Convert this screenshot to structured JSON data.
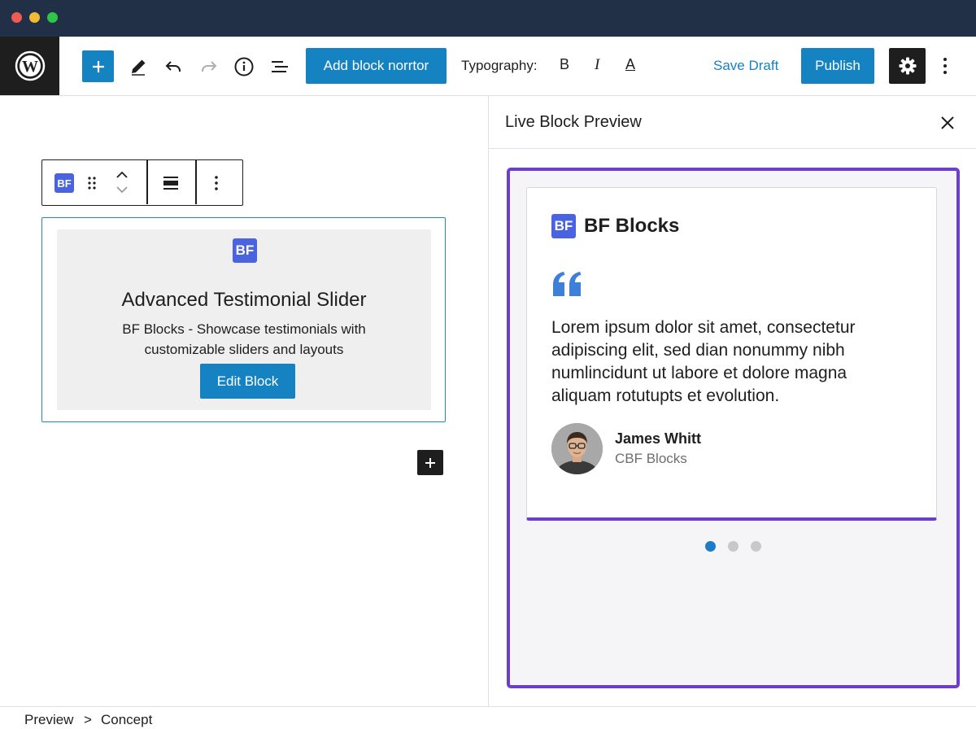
{
  "window": {
    "controls": [
      "close",
      "minimize",
      "zoom"
    ]
  },
  "toolbar": {
    "logo_icon": "wordpress-logo",
    "add_block_icon": "plus-icon",
    "tools": [
      "pencil-icon",
      "undo-icon",
      "redo-icon",
      "info-icon",
      "list-view-icon"
    ],
    "add_block_button": "Add block norrtor",
    "typography_label": "Typography:",
    "bold": "B",
    "italic": "I",
    "text_color": "A",
    "save_draft": "Save Draft",
    "publish": "Publish",
    "settings_icon": "gear-icon",
    "more_icon": "more-vertical-icon"
  },
  "editor": {
    "block_toolbar": {
      "badge": "BF",
      "drag_icon": "drag-handle-icon",
      "move_icons": [
        "chevron-up-icon",
        "chevron-down-icon"
      ],
      "align_icon": "align-full-icon",
      "more_icon": "more-vertical-icon"
    },
    "block": {
      "badge": "BF",
      "title": "Advanced Testimonial Slider",
      "description": "BF Blocks - Showcase testimonials with customizable sliders and layouts",
      "edit_button": "Edit Block"
    },
    "inline_add_icon": "plus-icon"
  },
  "panel": {
    "title": "Live Block Preview",
    "close_icon": "close-icon",
    "card": {
      "brand_badge": "BF",
      "brand_name": "BF Blocks",
      "quote_icon": "quote-icon",
      "quote": "Lorem ipsum dolor sit amet, consectetur adipiscing elit, sed dian nonummy nibh numlincidunt ut labore et dolore magna aliquam rotutupts et evolution.",
      "author_name": "James Whitt",
      "author_role": "CBF Blocks"
    },
    "slider": {
      "count": 3,
      "active_index": 0
    }
  },
  "footer": {
    "breadcrumb": [
      "Preview",
      "Concept"
    ],
    "separator": ">"
  },
  "colors": {
    "accent": "#1582c2",
    "preview_border": "#6b3fc9",
    "badge": "#4a63e0",
    "quote": "#3d7fd9",
    "titlebar": "#223047",
    "dark": "#1e1e1e"
  }
}
